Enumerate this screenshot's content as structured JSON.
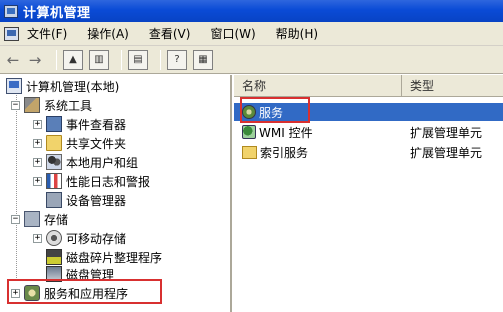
{
  "window": {
    "title": "计算机管理"
  },
  "menu": {
    "items": [
      "文件(F)",
      "操作(A)",
      "查看(V)",
      "窗口(W)",
      "帮助(H)"
    ]
  },
  "toolbar": {
    "back_icon": "back-arrow-icon",
    "forward_icon": "forward-arrow-icon",
    "buttons": [
      "up-folder-icon",
      "show-hide-tree-icon",
      "export-list-icon",
      "help-icon",
      "console-pane-icon"
    ]
  },
  "tree": {
    "root": "计算机管理(本地)",
    "system_tools": "系统工具",
    "event_viewer": "事件查看器",
    "shared_folders": "共享文件夹",
    "local_users": "本地用户和组",
    "perf_logs": "性能日志和警报",
    "device_manager": "设备管理器",
    "storage": "存储",
    "removable_storage": "可移动存储",
    "defrag": "磁盘碎片整理程序",
    "disk_mgmt": "磁盘管理",
    "services_apps": "服务和应用程序"
  },
  "list": {
    "col_name": "名称",
    "col_type": "类型",
    "rows": [
      {
        "name": "服务",
        "type": ""
      },
      {
        "name": "WMI 控件",
        "type": "扩展管理单元"
      },
      {
        "name": "索引服务",
        "type": "扩展管理单元"
      }
    ]
  },
  "colors": {
    "titlebar": "#0a4bd6",
    "selection": "#316ac5",
    "highlight_box": "#d83030",
    "chrome": "#ece9d8"
  }
}
